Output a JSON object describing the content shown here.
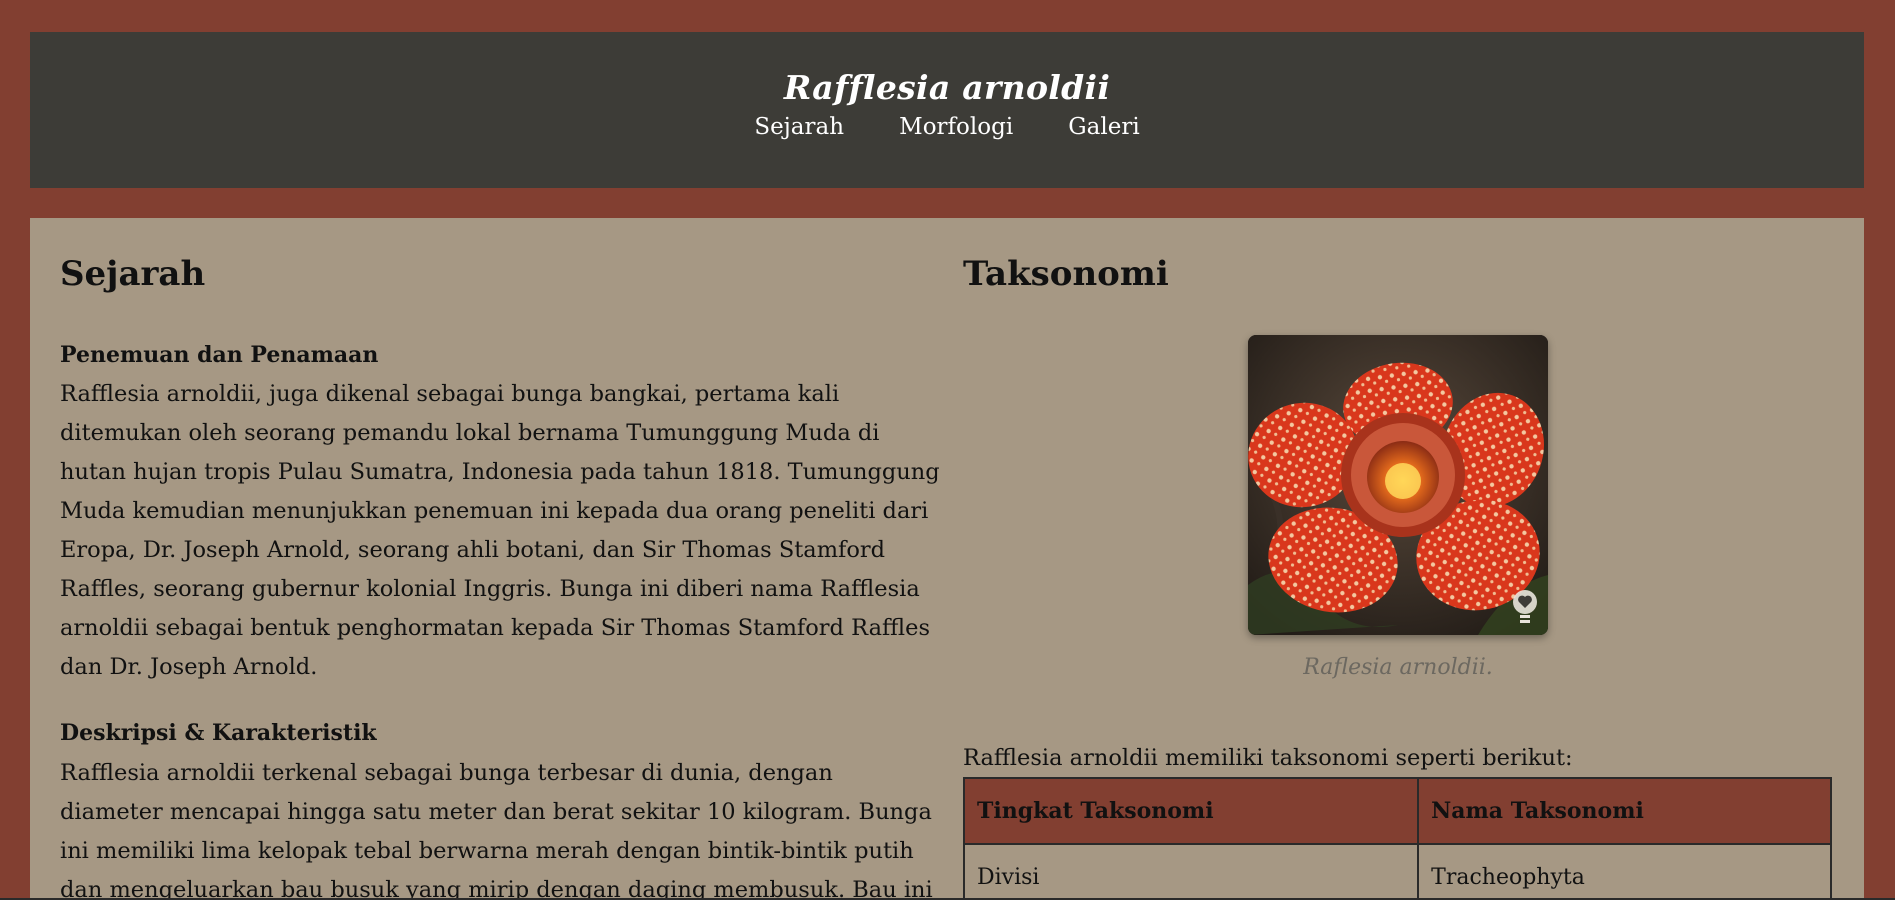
{
  "header": {
    "title": "Rafflesia arnoldii",
    "nav": [
      {
        "label": "Sejarah"
      },
      {
        "label": "Morfologi"
      },
      {
        "label": "Galeri"
      }
    ]
  },
  "sejarah": {
    "heading": "Sejarah",
    "sections": [
      {
        "title": "Penemuan dan Penamaan",
        "text": "Rafflesia arnoldii, juga dikenal sebagai bunga bangkai, pertama kali ditemukan oleh seorang pemandu lokal bernama Tumunggung Muda di hutan hujan tropis Pulau Sumatra, Indonesia pada tahun 1818. Tumunggung Muda kemudian menunjukkan penemuan ini kepada dua orang peneliti dari Eropa, Dr. Joseph Arnold, seorang ahli botani, dan Sir Thomas Stamford Raffles, seorang gubernur kolonial Inggris. Bunga ini diberi nama Rafflesia arnoldii sebagai bentuk penghormatan kepada Sir Thomas Stamford Raffles dan Dr. Joseph Arnold."
      },
      {
        "title": "Deskripsi & Karakteristik",
        "text": "Rafflesia arnoldii terkenal sebagai bunga terbesar di dunia, dengan diameter mencapai hingga satu meter dan berat sekitar 10 kilogram. Bunga ini memiliki lima kelopak tebal berwarna merah dengan bintik-bintik putih dan mengeluarkan bau busuk yang mirip dengan daging membusuk. Bau ini"
      }
    ]
  },
  "taksonomi": {
    "heading": "Taksonomi",
    "image_caption": "Raflesia arnoldii.",
    "image_icon": "lightbulb-heart-icon",
    "intro": "Rafflesia arnoldii memiliki taksonomi seperti berikut:",
    "table": {
      "headers": [
        "Tingkat Taksonomi",
        "Nama Taksonomi"
      ],
      "rows": [
        [
          "Divisi",
          "Tracheophyta"
        ]
      ]
    }
  },
  "colors": {
    "page_background": "#823f31",
    "header_background": "#3d3c37",
    "content_background": "#a69884",
    "table_header": "#823f31"
  }
}
